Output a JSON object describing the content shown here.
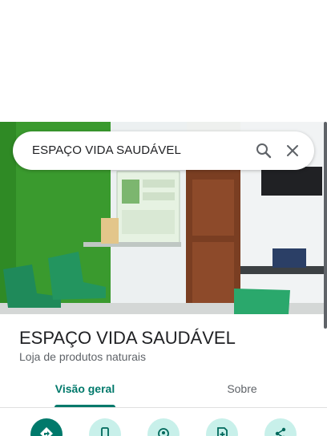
{
  "search": {
    "query": "ESPAÇO VIDA SAUDÁVEL"
  },
  "icons": {
    "search": "search-icon",
    "close": "close-icon",
    "directions": "directions-icon",
    "call": "phone-icon",
    "nearby": "nearby-icon",
    "save": "save-icon",
    "share": "share-icon"
  },
  "place": {
    "name": "ESPAÇO VIDA SAUDÁVEL",
    "category": "Loja de produtos naturais"
  },
  "tabs": [
    {
      "label": "Visão geral",
      "active": true
    },
    {
      "label": "Sobre",
      "active": false
    }
  ],
  "colors": {
    "accent": "#00796b",
    "action_light": "#c8f0ea",
    "wall_green": "#3a9a2e"
  }
}
